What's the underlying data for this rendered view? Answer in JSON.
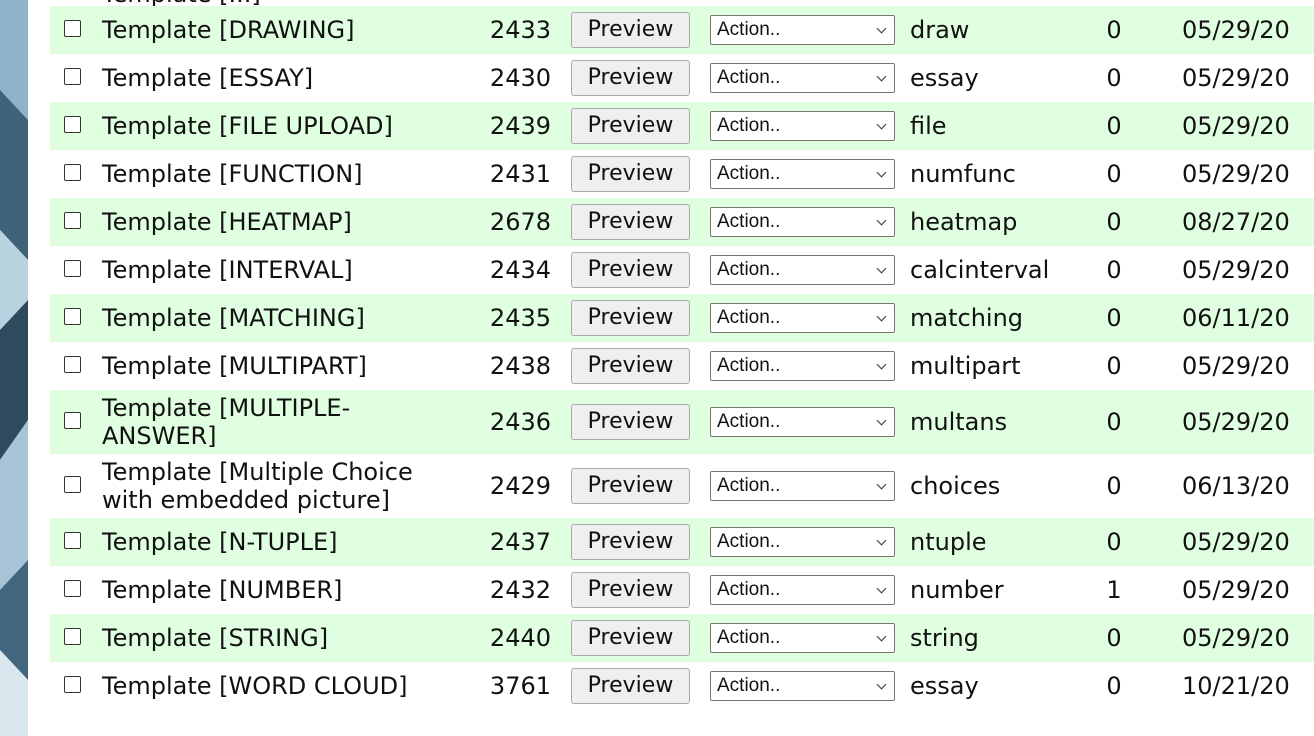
{
  "cutoff_text": "Template [...]",
  "preview_label": "Preview",
  "action_label": "Action..",
  "rows": [
    {
      "name": "Template [DRAWING]",
      "id": "2433",
      "type": "draw",
      "count": "0",
      "date": "05/29/20"
    },
    {
      "name": "Template [ESSAY]",
      "id": "2430",
      "type": "essay",
      "count": "0",
      "date": "05/29/20"
    },
    {
      "name": "Template [FILE UPLOAD]",
      "id": "2439",
      "type": "file",
      "count": "0",
      "date": "05/29/20"
    },
    {
      "name": "Template [FUNCTION]",
      "id": "2431",
      "type": "numfunc",
      "count": "0",
      "date": "05/29/20"
    },
    {
      "name": "Template [HEATMAP]",
      "id": "2678",
      "type": "heatmap",
      "count": "0",
      "date": "08/27/20"
    },
    {
      "name": "Template [INTERVAL]",
      "id": "2434",
      "type": "calcinterval",
      "count": "0",
      "date": "05/29/20"
    },
    {
      "name": "Template [MATCHING]",
      "id": "2435",
      "type": "matching",
      "count": "0",
      "date": "06/11/20"
    },
    {
      "name": "Template [MULTIPART]",
      "id": "2438",
      "type": "multipart",
      "count": "0",
      "date": "05/29/20"
    },
    {
      "name": "Template [MULTIPLE-ANSWER]",
      "id": "2436",
      "type": "multans",
      "count": "0",
      "date": "05/29/20"
    },
    {
      "name": "Template [Multiple Choice with embedded picture]",
      "id": "2429",
      "type": "choices",
      "count": "0",
      "date": "06/13/20"
    },
    {
      "name": "Template [N-TUPLE]",
      "id": "2437",
      "type": "ntuple",
      "count": "0",
      "date": "05/29/20"
    },
    {
      "name": "Template [NUMBER]",
      "id": "2432",
      "type": "number",
      "count": "1",
      "date": "05/29/20"
    },
    {
      "name": "Template [STRING]",
      "id": "2440",
      "type": "string",
      "count": "0",
      "date": "05/29/20"
    },
    {
      "name": "Template [WORD CLOUD]",
      "id": "3761",
      "type": "essay",
      "count": "0",
      "date": "10/21/20"
    }
  ]
}
